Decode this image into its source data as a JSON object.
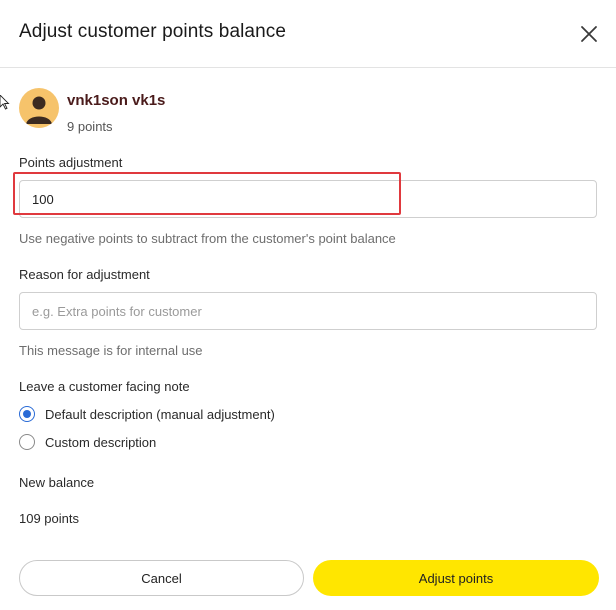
{
  "modal": {
    "title": "Adjust customer points balance"
  },
  "customer": {
    "name": "vnk1son vk1s",
    "points": "9 points"
  },
  "points_adjustment": {
    "label": "Points adjustment",
    "value": "100",
    "hint": "Use negative points to subtract from the customer's point balance"
  },
  "reason": {
    "label": "Reason for adjustment",
    "value": "",
    "placeholder": "e.g. Extra points for customer",
    "hint": "This message is for internal use"
  },
  "note": {
    "label": "Leave a customer facing note",
    "options": [
      {
        "label": "Default description (manual adjustment)",
        "checked": true
      },
      {
        "label": "Custom description",
        "checked": false
      }
    ]
  },
  "balance": {
    "label": "New balance",
    "value": "109 points"
  },
  "buttons": {
    "cancel": "Cancel",
    "adjust": "Adjust points"
  },
  "colors": {
    "accent": "#2a6bd6",
    "primary_button": "#ffe600",
    "highlight": "#e0393e",
    "avatar": "#f6c36b"
  },
  "icons": {
    "close": "close-icon",
    "avatar": "user-avatar-icon",
    "cursor": "mouse-pointer-icon"
  }
}
